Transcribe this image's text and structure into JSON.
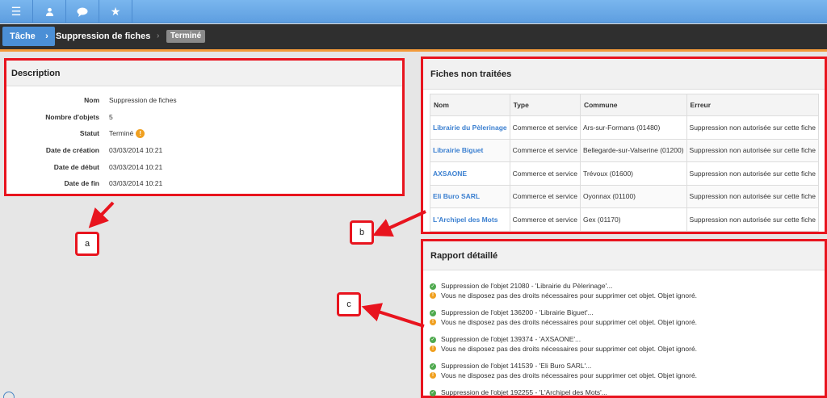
{
  "nav": {
    "icons": [
      "menu-icon",
      "user-icon",
      "chat-icon",
      "star-icon"
    ],
    "glyphs": [
      "☰",
      "👤",
      "💬",
      "★"
    ]
  },
  "breadcrumb": {
    "root": "Tâche",
    "title": "Suppression de fiches",
    "status": "Terminé"
  },
  "description": {
    "title": "Description",
    "rows": [
      {
        "label": "Nom",
        "value": "Suppression de fiches"
      },
      {
        "label": "Nombre d'objets",
        "value": "5"
      },
      {
        "label": "Statut",
        "value": "Terminé"
      },
      {
        "label": "Date de création",
        "value": "03/03/2014 10:21"
      },
      {
        "label": "Date de début",
        "value": "03/03/2014 10:21"
      },
      {
        "label": "Date de fin",
        "value": "03/03/2014 10:21"
      }
    ]
  },
  "fiches": {
    "title": "Fiches non traitées",
    "columns": [
      "Nom",
      "Type",
      "Commune",
      "Erreur"
    ],
    "rows": [
      [
        "Librairie du Pèlerinage",
        "Commerce et service",
        "Ars-sur-Formans (01480)",
        "Suppression non autorisée sur cette fiche"
      ],
      [
        "Librairie Biguet",
        "Commerce et service",
        "Bellegarde-sur-Valserine (01200)",
        "Suppression non autorisée sur cette fiche"
      ],
      [
        "AXSAONE",
        "Commerce et service",
        "Trévoux (01600)",
        "Suppression non autorisée sur cette fiche"
      ],
      [
        "Eli Buro SARL",
        "Commerce et service",
        "Oyonnax (01100)",
        "Suppression non autorisée sur cette fiche"
      ],
      [
        "L'Archipel des Mots",
        "Commerce et service",
        "Gex (01170)",
        "Suppression non autorisée sur cette fiche"
      ]
    ]
  },
  "rapport": {
    "title": "Rapport détaillé",
    "entries": [
      {
        "ok": "Suppression de l'objet 21080 - 'Librairie du Pèlerinage'...",
        "warn": "Vous ne disposez pas des droits nécessaires pour supprimer cet objet. Objet ignoré."
      },
      {
        "ok": "Suppression de l'objet 136200 - 'Librairie Biguet'...",
        "warn": "Vous ne disposez pas des droits nécessaires pour supprimer cet objet. Objet ignoré."
      },
      {
        "ok": "Suppression de l'objet 139374 - 'AXSAONE'...",
        "warn": "Vous ne disposez pas des droits nécessaires pour supprimer cet objet. Objet ignoré."
      },
      {
        "ok": "Suppression de l'objet 141539 - 'Eli Buro SARL'...",
        "warn": "Vous ne disposez pas des droits nécessaires pour supprimer cet objet. Objet ignoré."
      },
      {
        "ok": "Suppression de l'objet 192255 - 'L'Archipel des Mots'...",
        "warn": ""
      }
    ]
  },
  "callouts": {
    "a": "a",
    "b": "b",
    "c": "c"
  },
  "colors": {
    "highlight": "#e8141e",
    "accent": "#4b8fd6",
    "ok": "#4ea94e",
    "warn": "#f0a020"
  }
}
